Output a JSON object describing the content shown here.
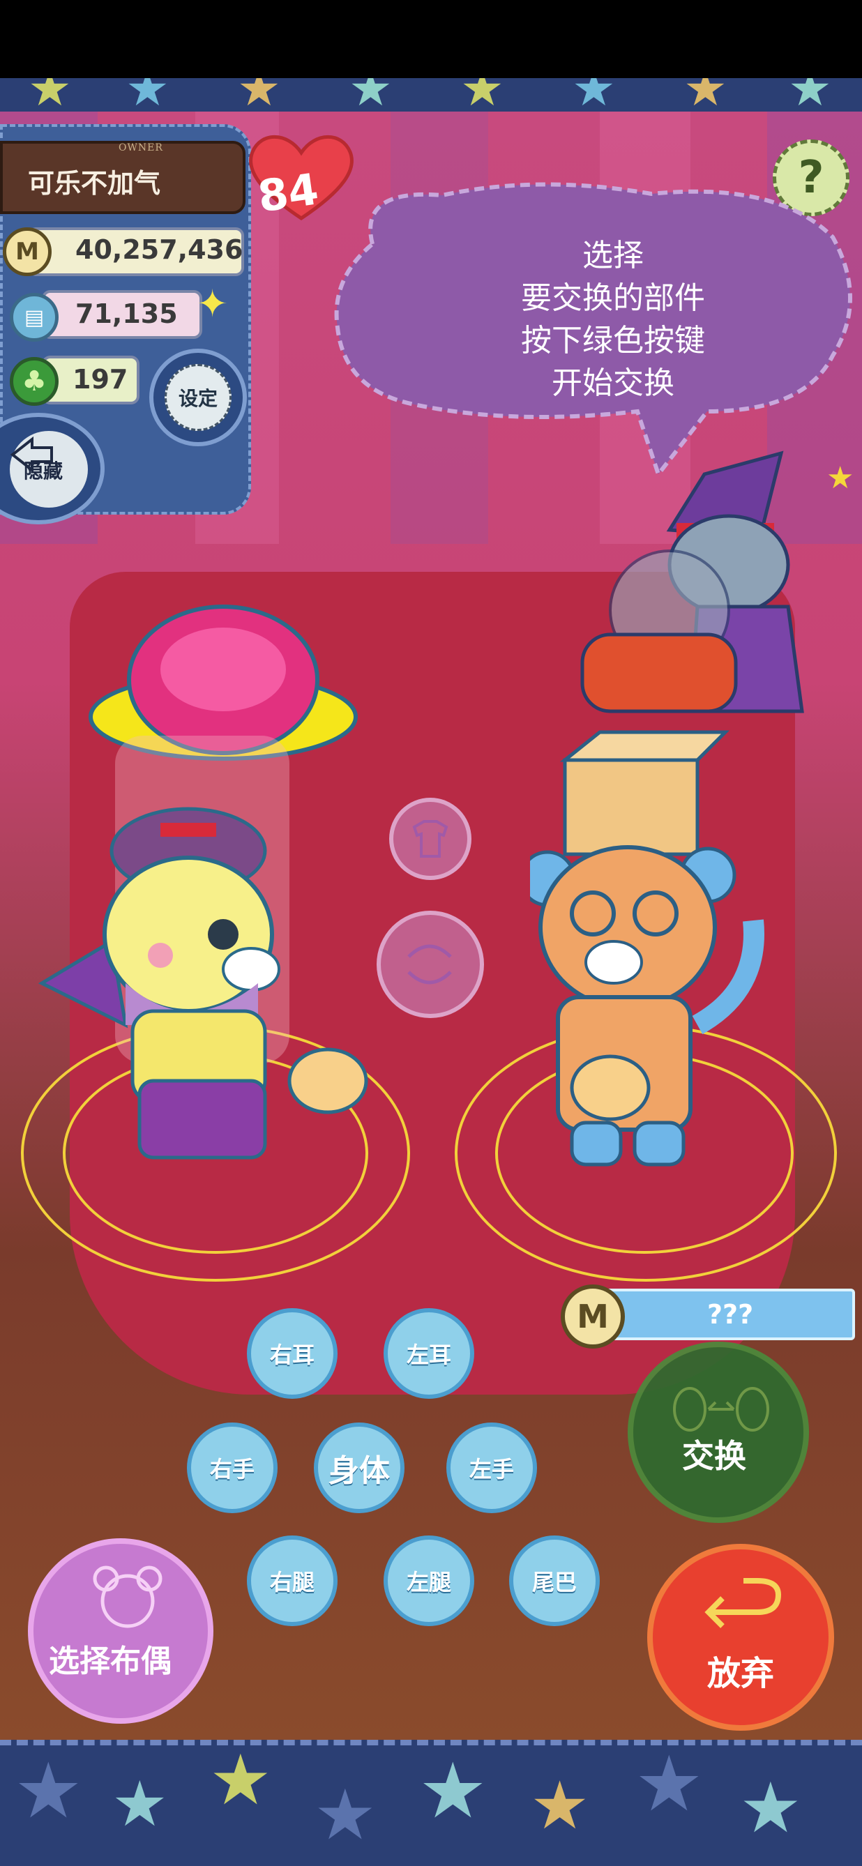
{
  "owner": {
    "tag": "OWNER",
    "name": "可乐不加气"
  },
  "level_badge": "84",
  "stats": {
    "coins": "40,257,436",
    "materials": "71,135",
    "clovers": "197"
  },
  "buttons": {
    "settings": "设定",
    "hide": "隐藏",
    "help": "?",
    "swap": "交换",
    "give_up": "放弃",
    "select_doll": "选择布偶"
  },
  "instruction": {
    "line1": "选择",
    "line2": "要交换的部件",
    "line3": "按下绿色按键",
    "line4": "开始交换"
  },
  "cost": {
    "coin_glyph": "M",
    "value": "???"
  },
  "parts": {
    "right_ear": "右耳",
    "left_ear": "左耳",
    "right_hand": "右手",
    "body": "身体",
    "left_hand": "左手",
    "right_leg": "右腿",
    "left_leg": "左腿",
    "tail": "尾巴"
  },
  "colors": {
    "accent_green": "#2e6b2f",
    "accent_red": "#e8402f",
    "part_blue": "#8fd0ea",
    "panel_blue": "#3e5f99"
  }
}
